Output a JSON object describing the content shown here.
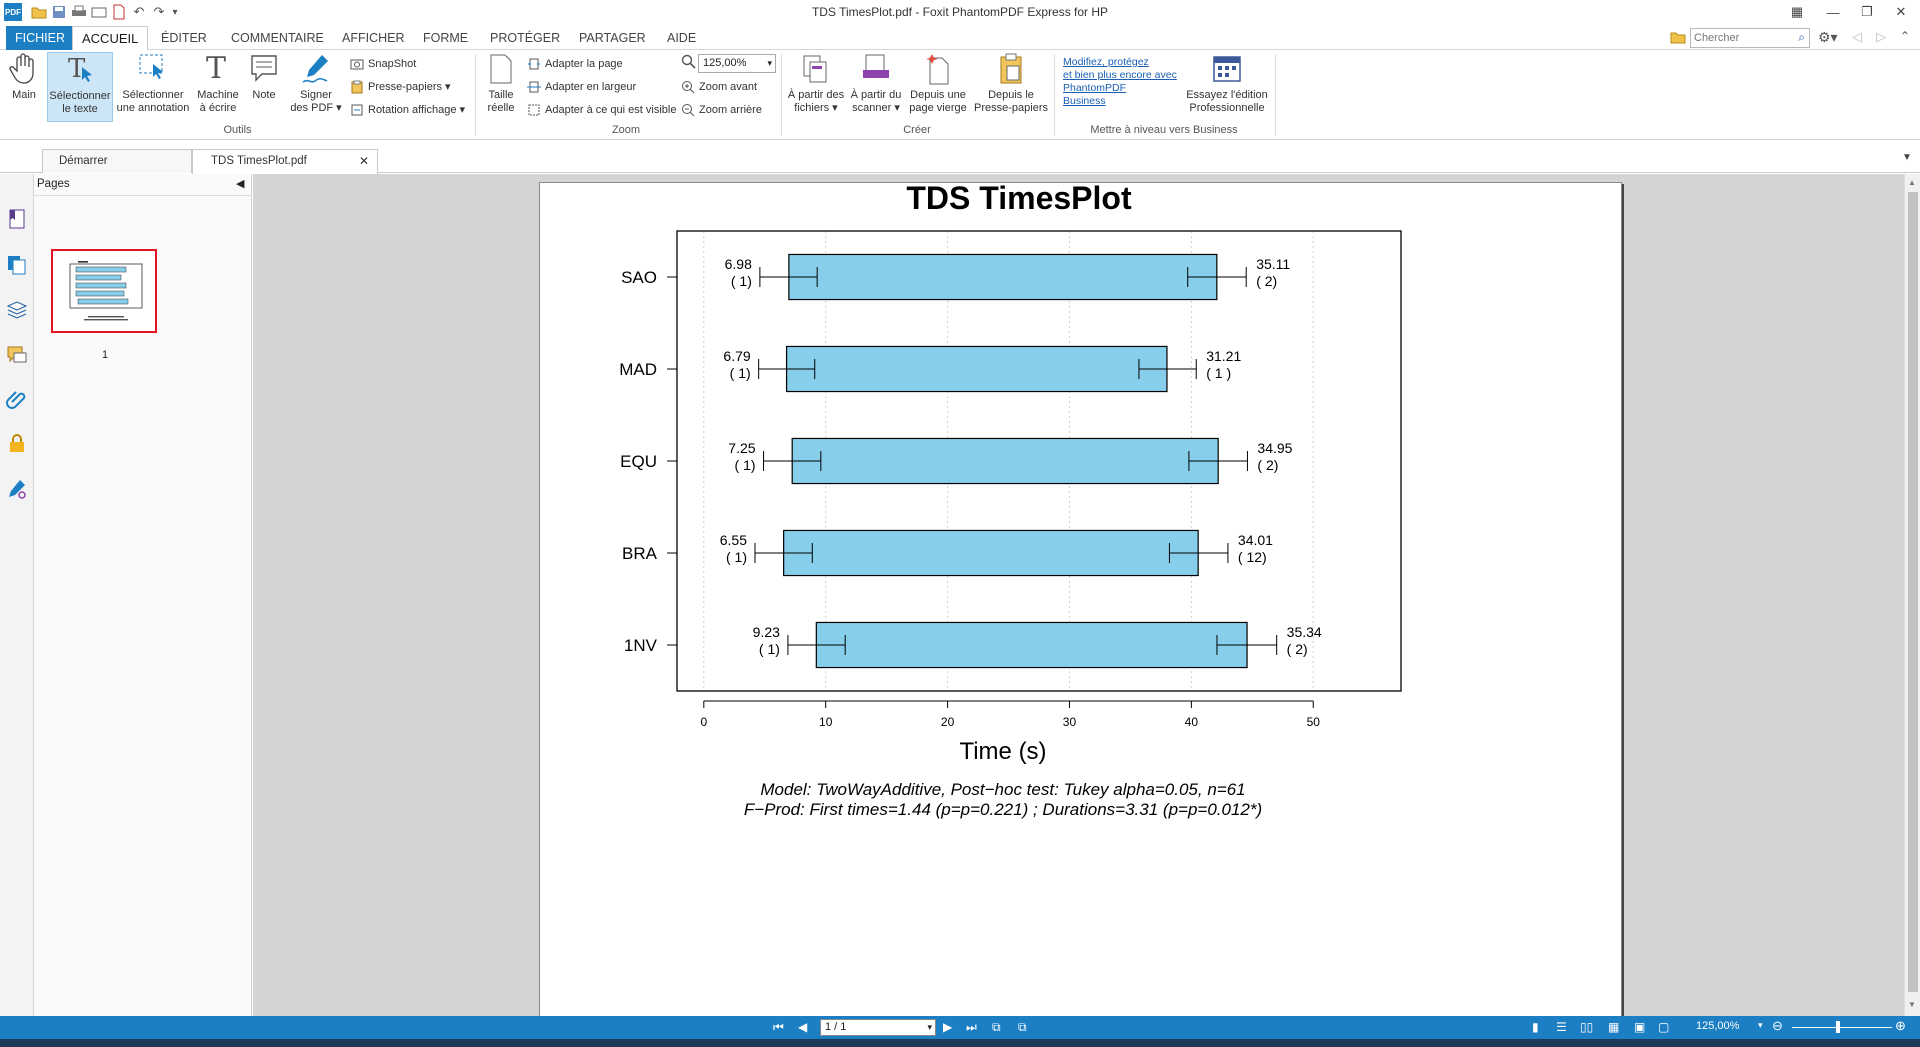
{
  "app": {
    "title": "TDS TimesPlot.pdf - Foxit PhantomPDF Express for HP",
    "app_icon_text": "PDF"
  },
  "menu": {
    "tabs": [
      "FICHIER",
      "ACCUEIL",
      "ÉDITER",
      "COMMENTAIRE",
      "AFFICHER",
      "FORME",
      "PROTÉGER",
      "PARTAGER",
      "AIDE"
    ],
    "search_placeholder": "Chercher"
  },
  "ribbon": {
    "outils": {
      "main": "Main",
      "select_text": [
        "Sélectionner",
        "le texte"
      ],
      "select_annot": [
        "Sélectionner",
        "une annotation"
      ],
      "typewriter": [
        "Machine",
        "à écrire"
      ],
      "note": "Note",
      "sign": [
        "Signer",
        "des PDF"
      ],
      "snapshot": "SnapShot",
      "clipboard": "Presse-papiers",
      "rotate": "Rotation affichage",
      "group": "Outils"
    },
    "zoom": {
      "actual": [
        "Taille",
        "réelle"
      ],
      "fit_page": "Adapter la page",
      "fit_width": "Adapter en largeur",
      "fit_visible": "Adapter à ce qui est visible",
      "zoom_value": "125,00%",
      "zoom_in": "Zoom avant",
      "zoom_out": "Zoom arrière",
      "group": "Zoom"
    },
    "creer": {
      "from_files": [
        "À partir des",
        "fichiers"
      ],
      "from_scanner": [
        "À partir du",
        "scanner"
      ],
      "blank": [
        "Depuis une",
        "page vierge"
      ],
      "clipboard": [
        "Depuis le",
        "Presse-papiers"
      ],
      "group": "Créer"
    },
    "upgrade": {
      "link_lines": [
        "Modifiez, protégez",
        "et bien plus encore avec",
        "PhantomPDF",
        "Business"
      ],
      "try": [
        "Essayez l'édition",
        "Professionnelle"
      ],
      "group": "Mettre à niveau vers Business"
    }
  },
  "doc_tabs": [
    "Démarrer",
    "TDS TimesPlot.pdf"
  ],
  "pages_panel": {
    "title": "Pages",
    "page_number": "1"
  },
  "status": {
    "page_field": "1 / 1",
    "zoom": "125,00%"
  },
  "chart_data": {
    "type": "bar",
    "title": "TDS TimesPlot",
    "xlabel": "Time (s)",
    "xlim": [
      -2.2,
      57.2
    ],
    "xticks": [
      0,
      10,
      20,
      30,
      40,
      50
    ],
    "categories": [
      "SAO",
      "MAD",
      "EQU",
      "BRA",
      "1NV"
    ],
    "bars": [
      {
        "label": "SAO",
        "start": 6.98,
        "end": 42.09,
        "lo_label": "6.98",
        "lo_count": "( 1)",
        "hi_label": "35.11",
        "hi_count": "( 2)",
        "lo_whisker": [
          4.6,
          9.3
        ],
        "hi_whisker": [
          39.7,
          44.5
        ]
      },
      {
        "label": "MAD",
        "start": 6.79,
        "end": 38.0,
        "lo_label": "6.79",
        "lo_count": "( 1)",
        "hi_label": "31.21",
        "hi_count": "( 1 )",
        "lo_whisker": [
          4.5,
          9.1
        ],
        "hi_whisker": [
          35.7,
          40.4
        ]
      },
      {
        "label": "EQU",
        "start": 7.25,
        "end": 42.2,
        "lo_label": "7.25",
        "lo_count": "( 1)",
        "hi_label": "34.95",
        "hi_count": "( 2)",
        "lo_whisker": [
          4.9,
          9.6
        ],
        "hi_whisker": [
          39.8,
          44.6
        ]
      },
      {
        "label": "BRA",
        "start": 6.55,
        "end": 40.56,
        "lo_label": "6.55",
        "lo_count": "( 1)",
        "hi_label": "34.01",
        "hi_count": "( 12)",
        "lo_whisker": [
          4.2,
          8.9
        ],
        "hi_whisker": [
          38.2,
          43.0
        ]
      },
      {
        "label": "1NV",
        "start": 9.23,
        "end": 44.57,
        "lo_label": "9.23",
        "lo_count": "( 1)",
        "hi_label": "35.34",
        "hi_count": "( 2)",
        "lo_whisker": [
          6.9,
          11.6
        ],
        "hi_whisker": [
          42.1,
          47.0
        ]
      }
    ],
    "annotations": [
      "Model: TwoWayAdditive, Post−hoc test: Tukey alpha=0.05, n=61",
      "F−Prod: First times=1.44 (p=p=0.221) ; Durations=3.31 (p=p=0.012*)"
    ],
    "bar_color": "#87ceeb",
    "grid": true
  }
}
